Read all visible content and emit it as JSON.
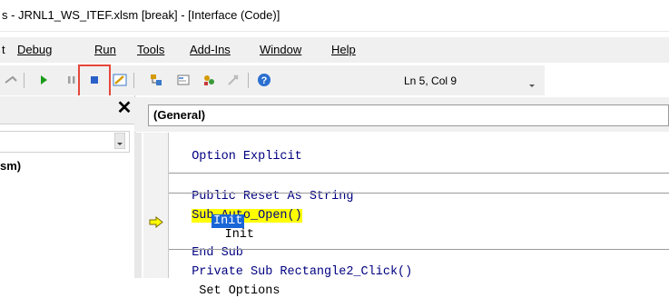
{
  "window": {
    "title": "s - JRNL1_WS_ITEF.xlsm [break] - [Interface (Code)]"
  },
  "menu": {
    "items": [
      {
        "label": "t",
        "underline_index": -1
      },
      {
        "label": "Debug",
        "underline_index": 0
      },
      {
        "label": "Run",
        "underline_index": 0
      },
      {
        "label": "Tools",
        "underline_index": 0
      },
      {
        "label": "Add-Ins",
        "underline_index": 0
      },
      {
        "label": "Window",
        "underline_index": 0
      },
      {
        "label": "Help",
        "underline_index": 0
      }
    ]
  },
  "toolbar": {
    "status": "Ln 5, Col 9",
    "accent_highlight": "#e6463c"
  },
  "left_pane": {
    "tree_text": "sm)"
  },
  "editor": {
    "object_combo": "(General)",
    "lines": [
      "Option Explicit",
      "",
      "Public Reset As String",
      "Sub Auto_Open()",
      "    Init",
      "End Sub",
      "Private Sub Rectangle2_Click()",
      " Set Options"
    ]
  }
}
